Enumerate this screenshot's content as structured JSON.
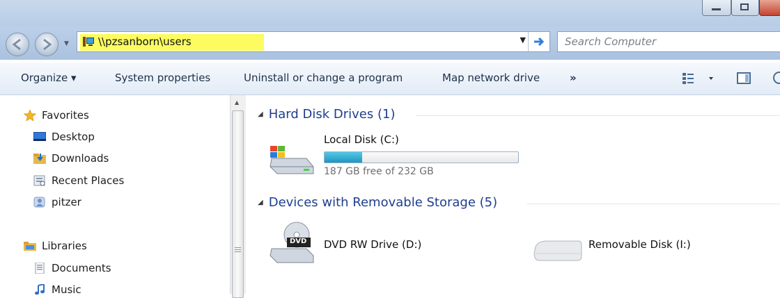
{
  "address": {
    "path": "\\\\pzsanborn\\users"
  },
  "search": {
    "placeholder": "Search Computer"
  },
  "toolbar": {
    "organize": "Organize ▾",
    "system_properties": "System properties",
    "uninstall": "Uninstall or change a program",
    "map_drive": "Map network drive",
    "more": "»"
  },
  "sidebar": {
    "favorites": "Favorites",
    "desktop": "Desktop",
    "downloads": "Downloads",
    "recent_places": "Recent Places",
    "pitzer": "pitzer",
    "libraries": "Libraries",
    "documents": "Documents",
    "music": "Music"
  },
  "groups": {
    "hard_disks": "Hard Disk Drives (1)",
    "removable": "Devices with Removable Storage (5)"
  },
  "drives": {
    "local_disk": {
      "label": "Local Disk (C:)",
      "free_text": "187 GB free of 232 GB",
      "used_fraction": 0.194
    },
    "dvd": {
      "label": "DVD RW Drive (D:)",
      "badge": "DVD"
    },
    "removable": {
      "label": "Removable Disk (I:)"
    }
  },
  "colors": {
    "accent": "#1e3e8f",
    "highlight": "#fcfc60"
  }
}
